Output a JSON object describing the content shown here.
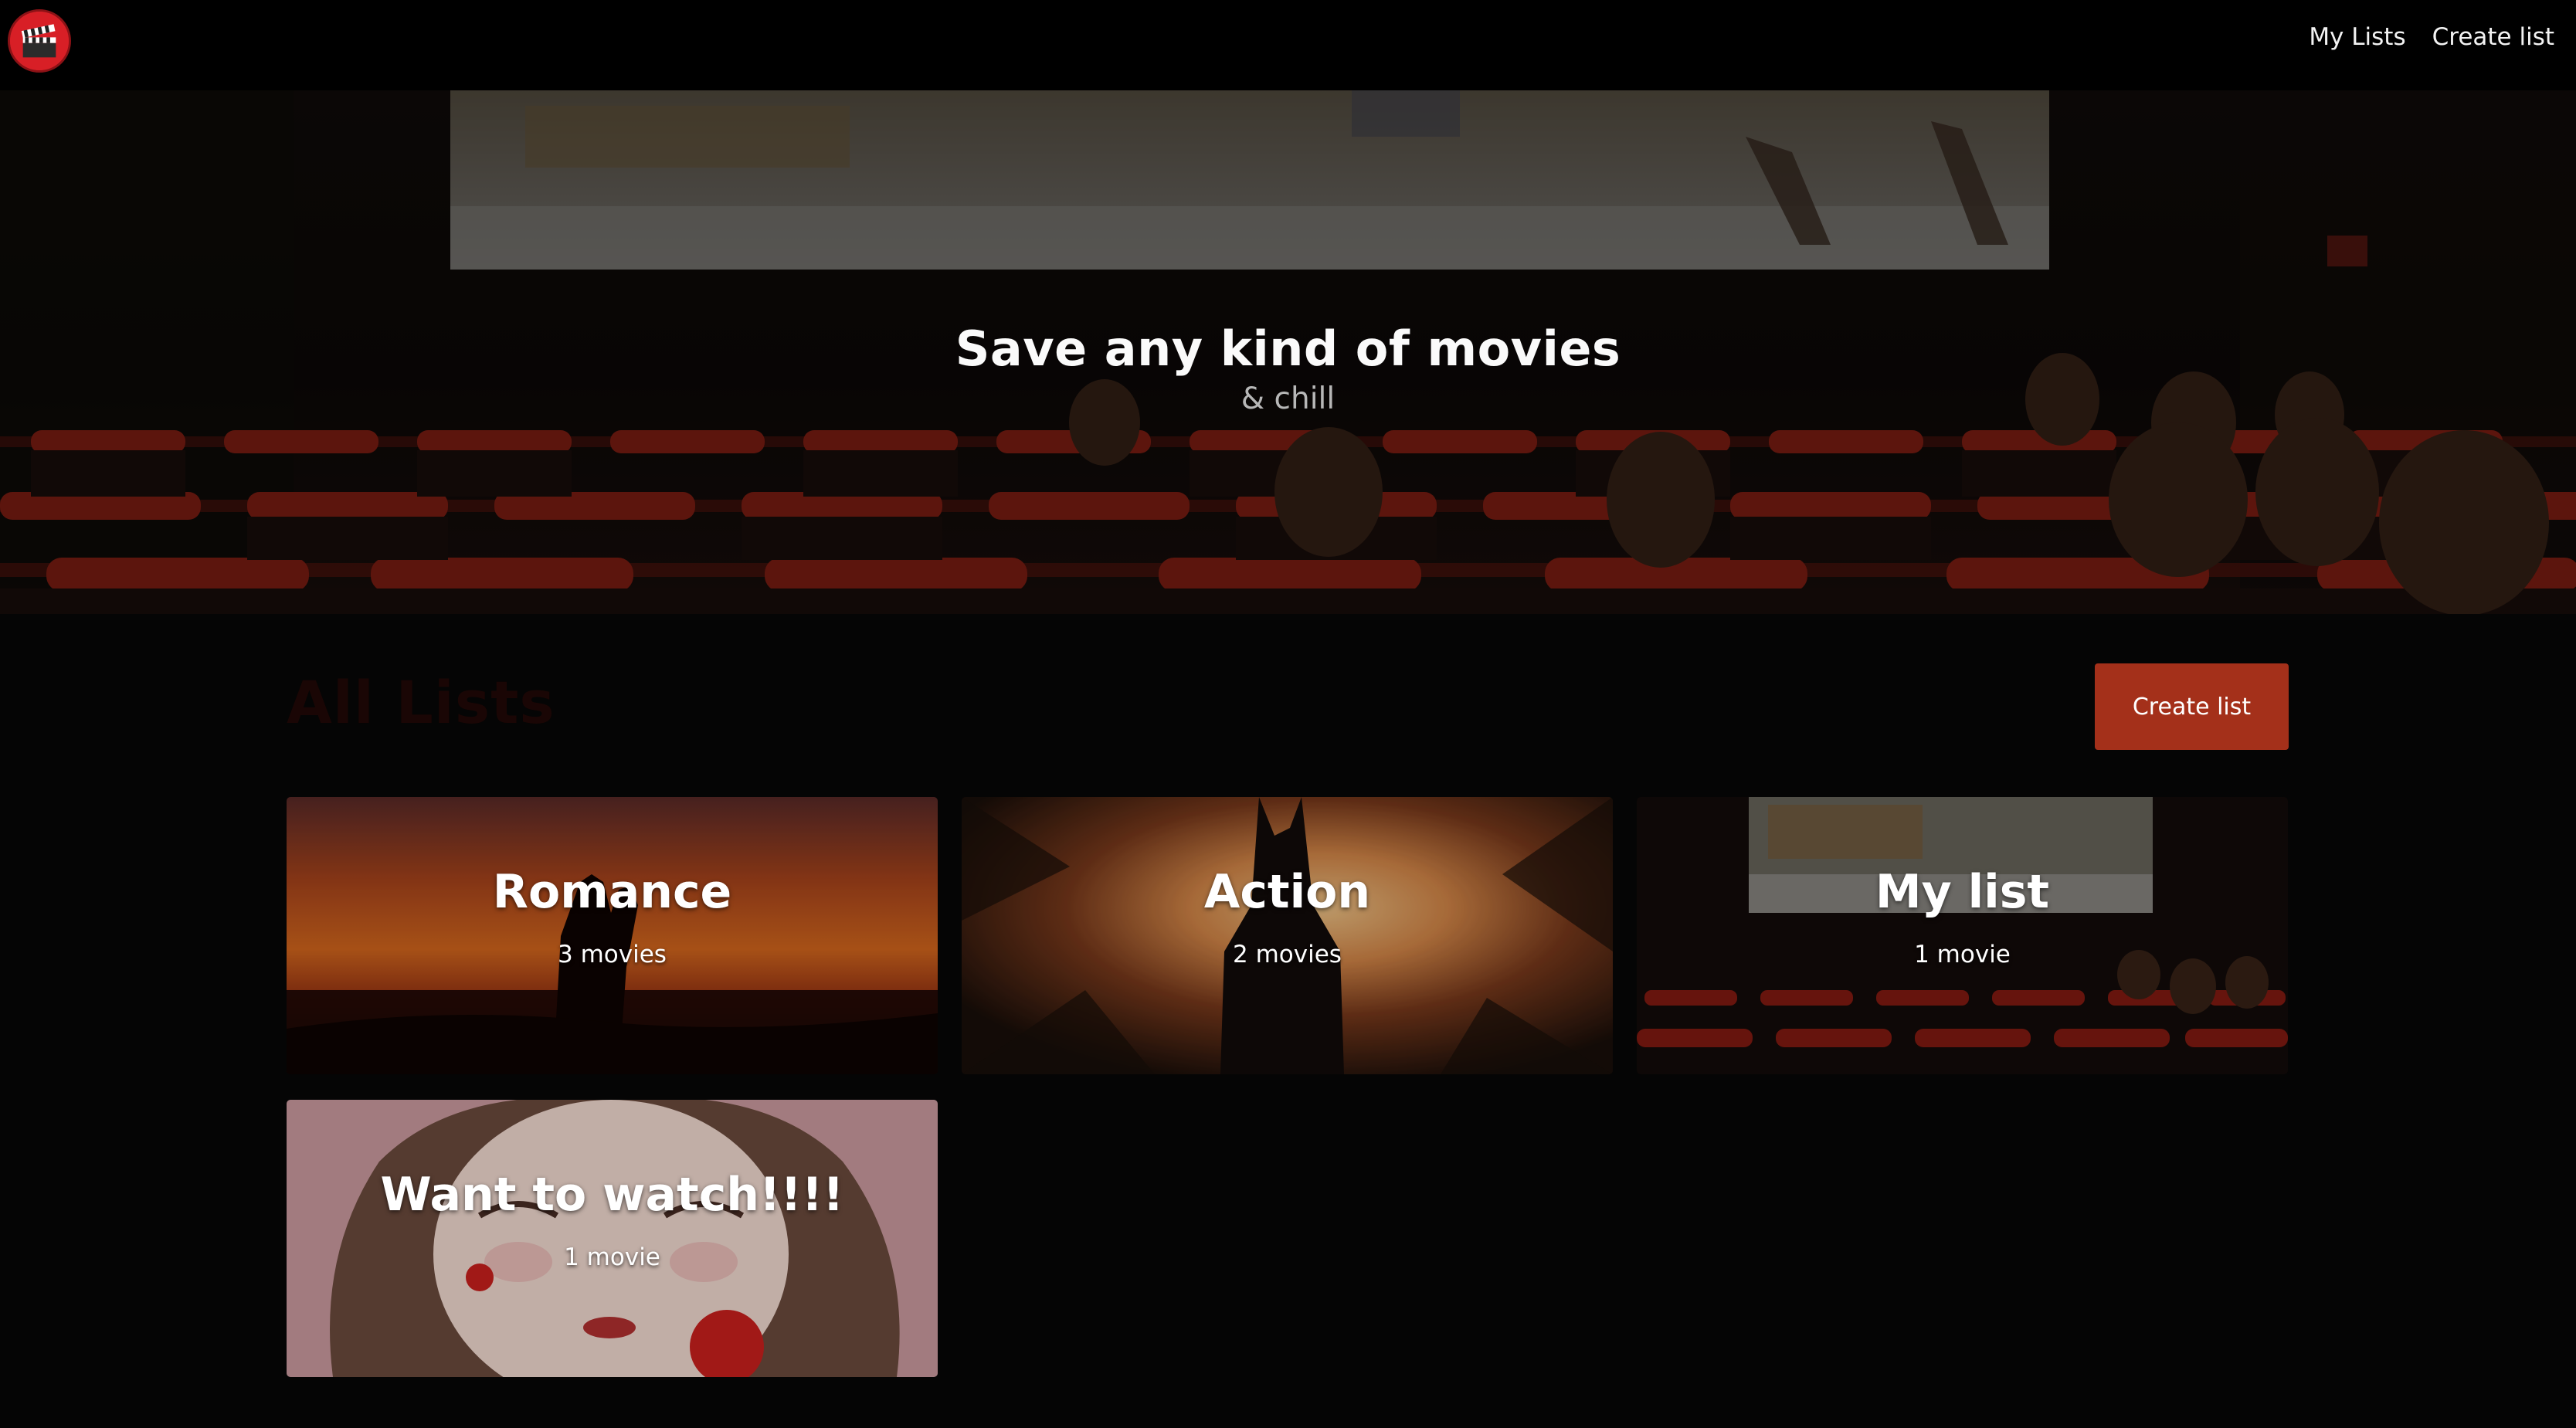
{
  "app": {
    "logo_icon": "clapperboard-icon",
    "accent_color": "#a4301a"
  },
  "navbar": {
    "links": [
      {
        "label": "My Lists"
      },
      {
        "label": "Create list"
      }
    ]
  },
  "hero": {
    "title": "Save any kind of movies",
    "subtitle": "& chill"
  },
  "lists_section": {
    "title": "All Lists",
    "create_button": "Create list"
  },
  "lists": [
    {
      "name": "Romance",
      "count": "3 movies"
    },
    {
      "name": "Action",
      "count": "2 movies"
    },
    {
      "name": "My list",
      "count": "1 movie"
    },
    {
      "name": "Want to watch!!!!",
      "count": "1 movie"
    }
  ]
}
